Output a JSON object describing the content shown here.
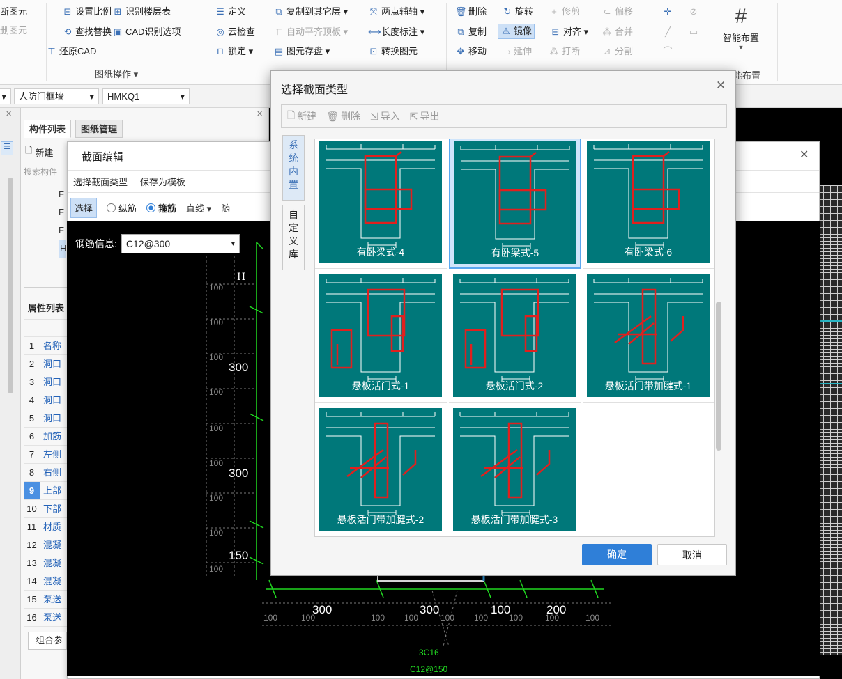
{
  "ribbon": {
    "col0": [
      "断图元",
      "删图元"
    ],
    "draw_ops": {
      "set_ratio": "设置比例",
      "identify_floor_table": "识别楼层表",
      "find_replace": "查找替换",
      "cad_options": "CAD识别选项",
      "restore_cad": "还原CAD",
      "group_label": "图纸操作 ▾"
    },
    "general": {
      "define": "定义",
      "cloud_check": "云检查",
      "lock": "锁定 ▾",
      "copy_to_floor": "复制到其它层 ▾",
      "auto_align": "自动平齐顶板 ▾",
      "elem_storage": "图元存盘 ▾",
      "two_point_axis": "两点辅轴 ▾",
      "length_dim": "长度标注 ▾",
      "convert_elem": "转换图元"
    },
    "modify": {
      "delete": "删除",
      "rotate": "旋转",
      "trim": "修剪",
      "offset": "偏移",
      "copy": "复制",
      "mirror": "镜像",
      "align": "对齐 ▾",
      "merge": "合并",
      "move": "移动",
      "extend": "延伸",
      "break": "打断",
      "split": "分割"
    },
    "smart": {
      "label": "智能布置",
      "group_label": "能布置"
    }
  },
  "toolbar2": {
    "wall_type": "人防门框墙",
    "component": "HMKQ1"
  },
  "left_panel": {
    "tab_list": "构件列表",
    "tab_draw": "图纸管理",
    "new_btn": "新建",
    "search_placeholder": "搜索构件",
    "list_letters": [
      "F",
      "F",
      "F",
      "H"
    ],
    "props_title": "属性列表",
    "combine_btn": "组合参",
    "rows": [
      {
        "n": "1",
        "l": "名称"
      },
      {
        "n": "2",
        "l": "洞口"
      },
      {
        "n": "3",
        "l": "洞口"
      },
      {
        "n": "4",
        "l": "洞口"
      },
      {
        "n": "5",
        "l": "洞口"
      },
      {
        "n": "6",
        "l": "加筋"
      },
      {
        "n": "7",
        "l": "左侧"
      },
      {
        "n": "8",
        "l": "右侧"
      },
      {
        "n": "9",
        "l": "上部"
      },
      {
        "n": "10",
        "l": "下部"
      },
      {
        "n": "11",
        "l": "材质"
      },
      {
        "n": "12",
        "l": "混凝"
      },
      {
        "n": "13",
        "l": "混凝"
      },
      {
        "n": "14",
        "l": "混凝"
      },
      {
        "n": "15",
        "l": "泵送"
      },
      {
        "n": "16",
        "l": "泵送"
      }
    ]
  },
  "section_editor": {
    "title": "截面编辑",
    "menu_select_type": "选择截面类型",
    "menu_save_template": "保存为模板",
    "select": "选择",
    "longitudinal": "纵筋",
    "stirrup": "箍筋",
    "line": "直线 ▾",
    "partial": "随",
    "rebar_info_label": "钢筋信息:",
    "rebar_info_value": "C12@300",
    "cad_labels": {
      "h": "H",
      "dim300a": "300",
      "dim300b": "300",
      "dim150": "150",
      "bot300a": "300",
      "bot300b": "300",
      "bot100": "100",
      "bot200": "200",
      "rebar1": "3C16",
      "rebar2": "C12@150",
      "small100": "100"
    }
  },
  "dialog": {
    "title": "选择截面类型",
    "new": "新建",
    "delete": "删除",
    "import": "导入",
    "export": "导出",
    "tab_system": "系统内置",
    "tab_custom": "自定义库",
    "ok": "确定",
    "cancel": "取消",
    "items": [
      "有卧梁式-4",
      "有卧梁式-5",
      "有卧梁式-6",
      "悬板活门式-1",
      "悬板活门式-2",
      "悬板活门带加腱式-1",
      "悬板活门带加腱式-2",
      "悬板活门带加腱式-3"
    ],
    "selected_index": 1
  },
  "colors": {
    "accent": "#2f7fd8",
    "thumb_bg": "#00787a",
    "rebar": "#e0201e",
    "cad_green": "#22dd22"
  }
}
